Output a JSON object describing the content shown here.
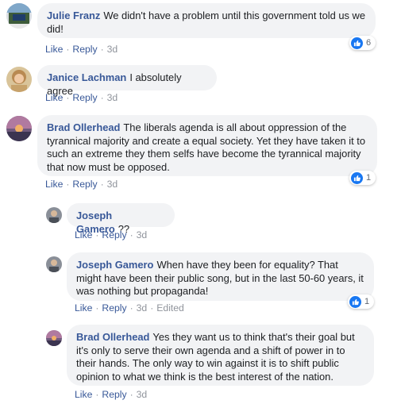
{
  "comments": [
    {
      "author": "Julie Franz",
      "text": "We didn't have a problem until this government told us we did!",
      "like_label": "Like",
      "reply_label": "Reply",
      "time": "3d",
      "reactions": "6",
      "avatar_icon": "profile-photo"
    },
    {
      "author": "Janice Lachman",
      "text": "I absolutely agree",
      "like_label": "Like",
      "reply_label": "Reply",
      "time": "3d",
      "avatar_icon": "profile-photo"
    },
    {
      "author": "Brad Ollerhead",
      "text": "The liberals agenda is all about oppression of the tyrannical majority and create a equal society. Yet they have taken it to such an extreme they them selfs have become the tyrannical majority that now must be opposed.",
      "like_label": "Like",
      "reply_label": "Reply",
      "time": "3d",
      "reactions": "1",
      "avatar_icon": "profile-photo"
    }
  ],
  "replies": [
    {
      "author": "Joseph Gamero",
      "text": "??",
      "like_label": "Like",
      "reply_label": "Reply",
      "time": "3d",
      "avatar_icon": "profile-photo"
    },
    {
      "author": "Joseph Gamero",
      "text": "When have they been for equality? That might have been their public song, but in the last 50-60 years, it was nothing but propaganda!",
      "like_label": "Like",
      "reply_label": "Reply",
      "time": "3d",
      "edited": "Edited",
      "reactions": "1",
      "avatar_icon": "profile-photo"
    },
    {
      "author": "Brad Ollerhead",
      "text": "Yes they want us to think that's their goal but it's only to serve their own agenda and a shift of power in to their hands. The only way to win against it is to shift public opinion to what we think is the best interest of the nation.",
      "like_label": "Like",
      "reply_label": "Reply",
      "time": "3d",
      "avatar_icon": "profile-photo"
    }
  ],
  "colors": {
    "author": "#385898",
    "bubble": "#f2f3f5",
    "like_blue": "#1877f2",
    "meta_gray": "#90949c"
  }
}
